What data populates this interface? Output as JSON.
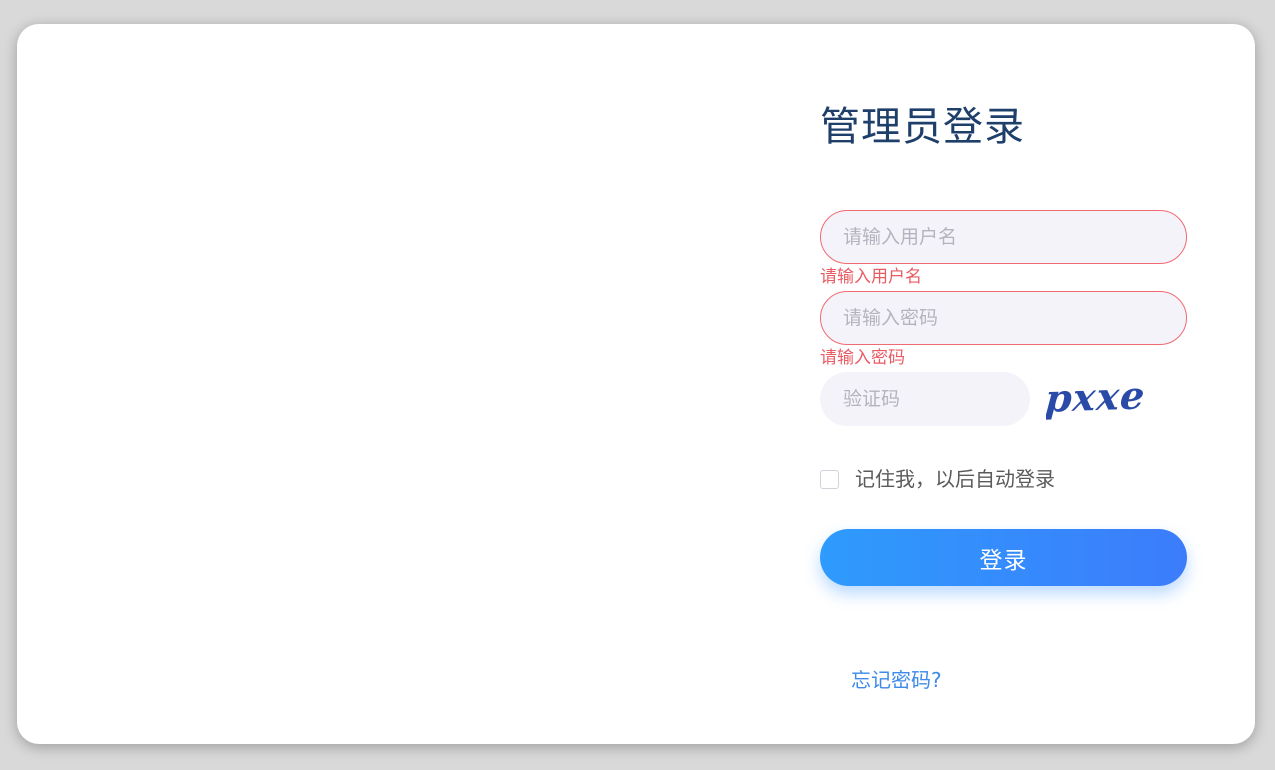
{
  "login": {
    "title": "管理员登录",
    "username_placeholder": "请输入用户名",
    "username_error": "请输入用户名",
    "password_placeholder": "请输入密码",
    "password_error": "请输入密码",
    "captcha_placeholder": "验证码",
    "captcha_text": "pxxe",
    "remember_label": "记住我，以后自动登录",
    "remember_checked": false,
    "submit_label": "登录",
    "forgot_label": "忘记密码?"
  },
  "colors": {
    "title": "#1f3f6b",
    "error": "#e85b63",
    "button_start": "#2e9bfd",
    "button_end": "#3c7cfb",
    "link": "#3d8ae8",
    "captcha": "#2a4aa8",
    "input_bg": "#f5f3fa"
  }
}
